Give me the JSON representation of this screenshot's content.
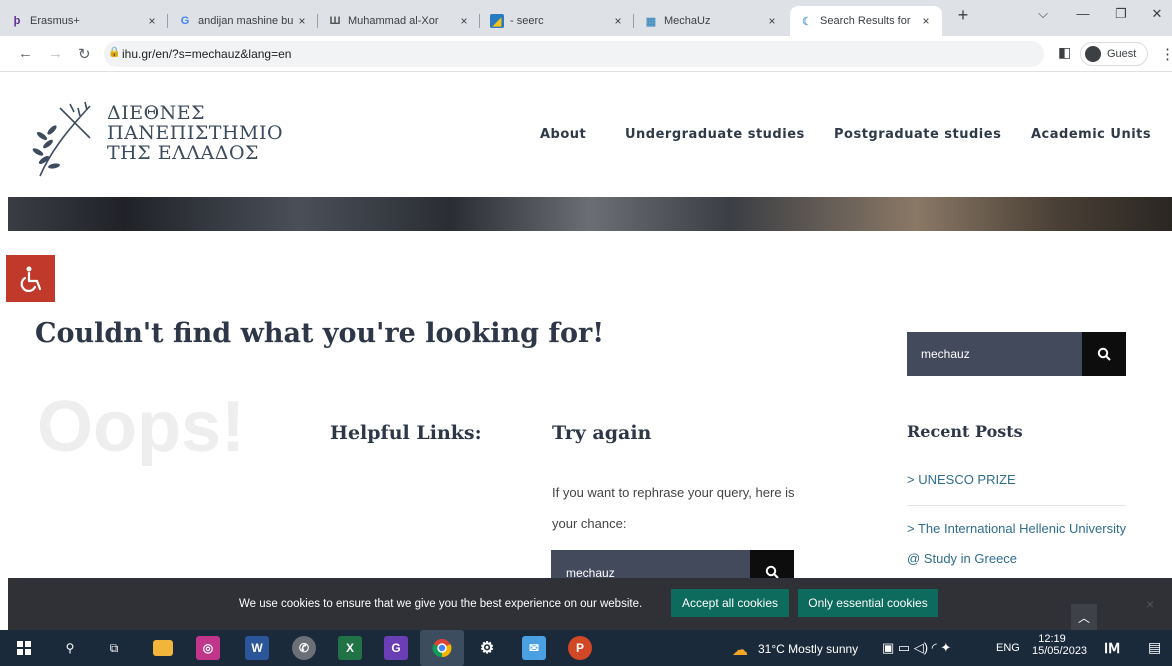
{
  "browser": {
    "tabs": [
      {
        "label": "Erasmus+",
        "icon": "erasmus-icon",
        "color": "#5b2d90"
      },
      {
        "label": "andijan mashine bu",
        "icon": "google-icon",
        "color": "#4285f4"
      },
      {
        "label": "Muhammad al-Xor",
        "icon": "wikipedia-icon",
        "color": "#555555"
      },
      {
        "label": "- seerc",
        "icon": "seerc-icon",
        "color": "#2a7abf"
      },
      {
        "label": "MechaUz",
        "icon": "mechauz-icon",
        "color": "#4a90c0"
      },
      {
        "label": "Search Results for",
        "icon": "ihu-icon",
        "color": "#6aa6d6"
      }
    ],
    "new_tab": "+",
    "close_glyph": "×",
    "url": "ihu.gr/en/?s=mechauz&lang=en",
    "profile": "Guest"
  },
  "site": {
    "logo_lines": [
      "ΔΙΕΘΝΕΣ",
      "ΠΑΝΕΠΙΣΤΗΜΙΟ",
      "ΤΗΣ ΕΛΛΑΔΟΣ"
    ],
    "nav": [
      "About",
      "Undergraduate studies",
      "Postgraduate studies",
      "Academic Units"
    ]
  },
  "main": {
    "headline": "Couldn't find what you're looking for!",
    "oops": "Oops!",
    "helpful_links": "Helpful Links:",
    "try_again": "Try again",
    "try_description": "If you want to rephrase your query, here is your chance:",
    "search_value": "mechauz"
  },
  "sidebar": {
    "search_value": "mechauz",
    "recent_posts_title": "Recent Posts",
    "posts": [
      "> UNESCO PRIZE",
      "> The International Hellenic University @ Study in Greece"
    ]
  },
  "cookie": {
    "message": "We use cookies to ensure that we give you the best experience on our website.",
    "accept_all": "Accept all cookies",
    "essential_only": "Only essential cookies",
    "close": "×"
  },
  "taskbar": {
    "weather": "31°C  Mostly sunny",
    "lang": "ENG",
    "time": "12:19",
    "date": "15/05/2023"
  }
}
